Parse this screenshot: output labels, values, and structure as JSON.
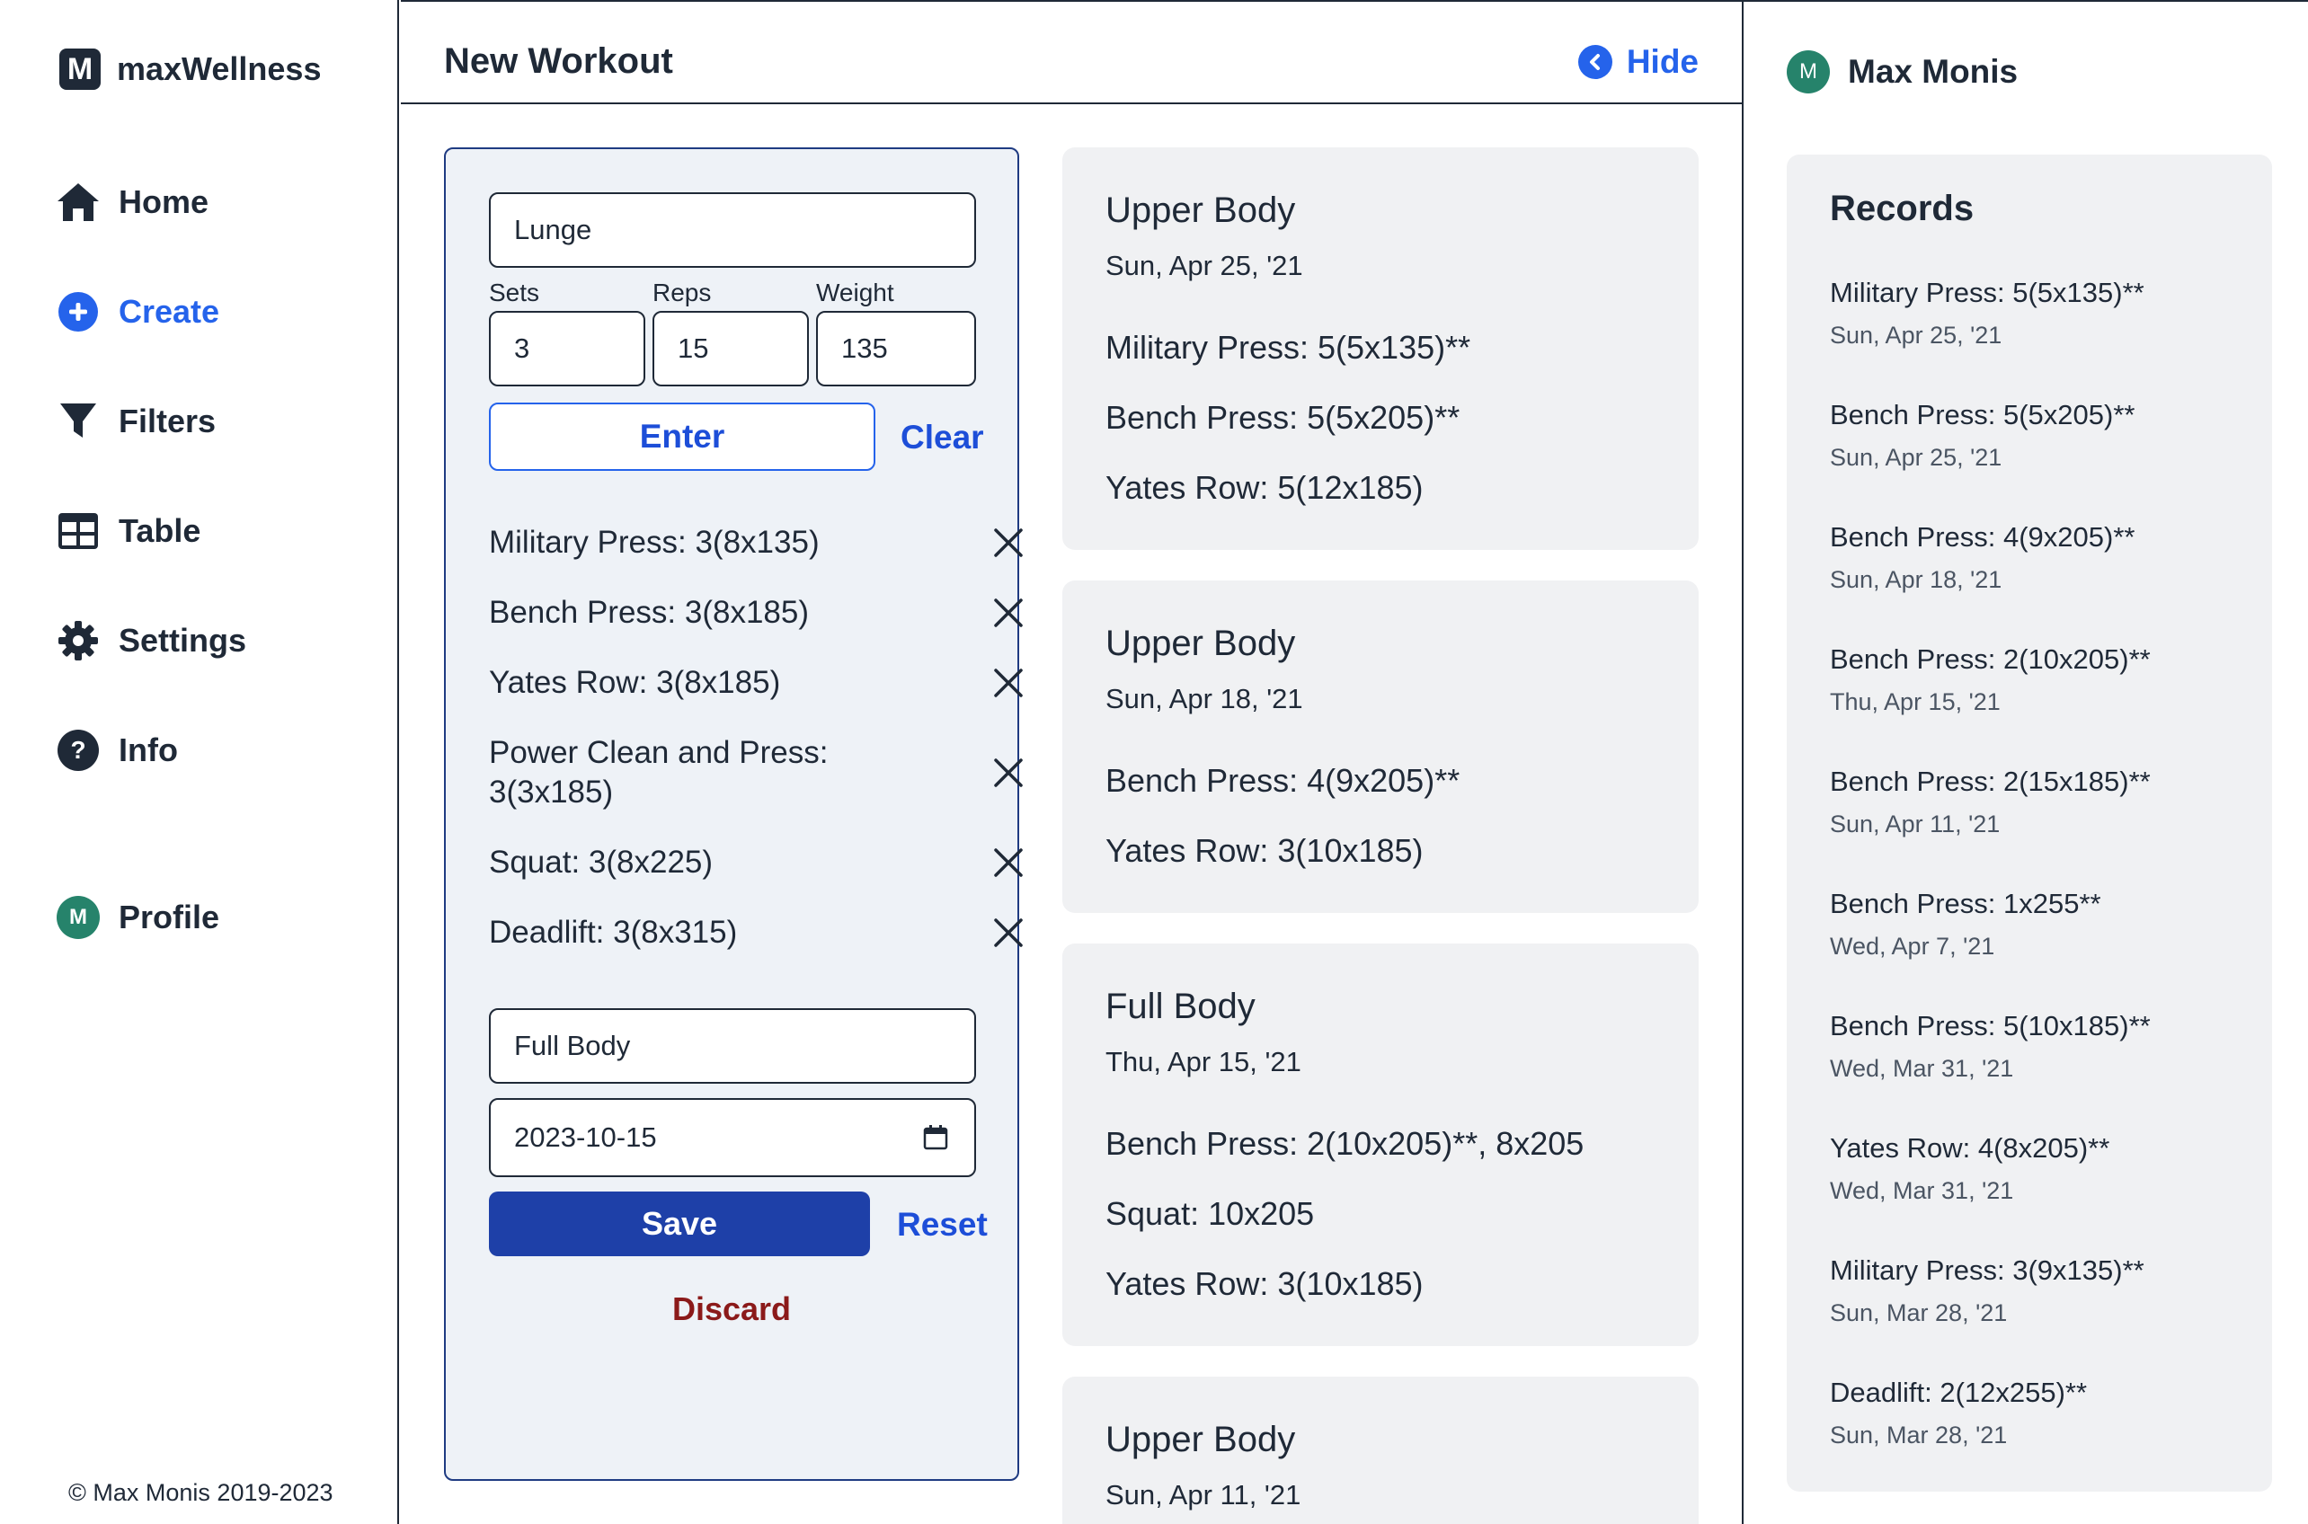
{
  "app": {
    "name": "maxWellness",
    "logo_letter": "M"
  },
  "nav": {
    "home": "Home",
    "create": "Create",
    "filters": "Filters",
    "table": "Table",
    "settings": "Settings",
    "info": "Info",
    "profile": "Profile",
    "profile_initial": "M"
  },
  "footer": {
    "copyright": "© Max Monis 2019-2023"
  },
  "header": {
    "title": "New Workout",
    "hide_label": "Hide"
  },
  "form": {
    "exercise_value": "Lunge",
    "sets_label": "Sets",
    "reps_label": "Reps",
    "weight_label": "Weight",
    "sets_value": "3",
    "reps_value": "15",
    "weight_value": "135",
    "enter_label": "Enter",
    "clear_label": "Clear",
    "exercises": [
      "Military Press: 3(8x135)",
      "Bench Press: 3(8x185)",
      "Yates Row: 3(8x185)",
      "Power Clean and Press: 3(3x185)",
      "Squat: 3(8x225)",
      "Deadlift: 3(8x315)"
    ],
    "workout_name": "Full Body",
    "date_value": "2023-10-15",
    "save_label": "Save",
    "reset_label": "Reset",
    "discard_label": "Discard"
  },
  "workouts": [
    {
      "title": "Upper Body",
      "date": "Sun, Apr 25, '21",
      "lines": [
        "Military Press: 5(5x135)**",
        "Bench Press: 5(5x205)**",
        "Yates Row: 5(12x185)"
      ]
    },
    {
      "title": "Upper Body",
      "date": "Sun, Apr 18, '21",
      "lines": [
        "Bench Press: 4(9x205)**",
        "Yates Row: 3(10x185)"
      ]
    },
    {
      "title": "Full Body",
      "date": "Thu, Apr 15, '21",
      "lines": [
        "Bench Press: 2(10x205)**, 8x205",
        "Squat: 10x205",
        "Yates Row: 3(10x185)"
      ]
    },
    {
      "title": "Upper Body",
      "date": "Sun, Apr 11, '21",
      "lines": []
    }
  ],
  "user": {
    "name": "Max Monis",
    "initial": "M"
  },
  "records": {
    "title": "Records",
    "items": [
      {
        "name": "Military Press: 5(5x135)**",
        "date": "Sun, Apr 25, '21"
      },
      {
        "name": "Bench Press: 5(5x205)**",
        "date": "Sun, Apr 25, '21"
      },
      {
        "name": "Bench Press: 4(9x205)**",
        "date": "Sun, Apr 18, '21"
      },
      {
        "name": "Bench Press: 2(10x205)**",
        "date": "Thu, Apr 15, '21"
      },
      {
        "name": "Bench Press: 2(15x185)**",
        "date": "Sun, Apr 11, '21"
      },
      {
        "name": "Bench Press: 1x255**",
        "date": "Wed, Apr 7, '21"
      },
      {
        "name": "Bench Press: 5(10x185)**",
        "date": "Wed, Mar 31, '21"
      },
      {
        "name": "Yates Row: 4(8x205)**",
        "date": "Wed, Mar 31, '21"
      },
      {
        "name": "Military Press: 3(9x135)**",
        "date": "Sun, Mar 28, '21"
      },
      {
        "name": "Deadlift: 2(12x255)**",
        "date": "Sun, Mar 28, '21"
      }
    ]
  },
  "colors": {
    "accent": "#2563eb",
    "save": "#1e40a8",
    "discard": "#8b1a1a",
    "avatar": "#26836b",
    "panel": "#eef2f7",
    "card": "#f0f1f3"
  }
}
